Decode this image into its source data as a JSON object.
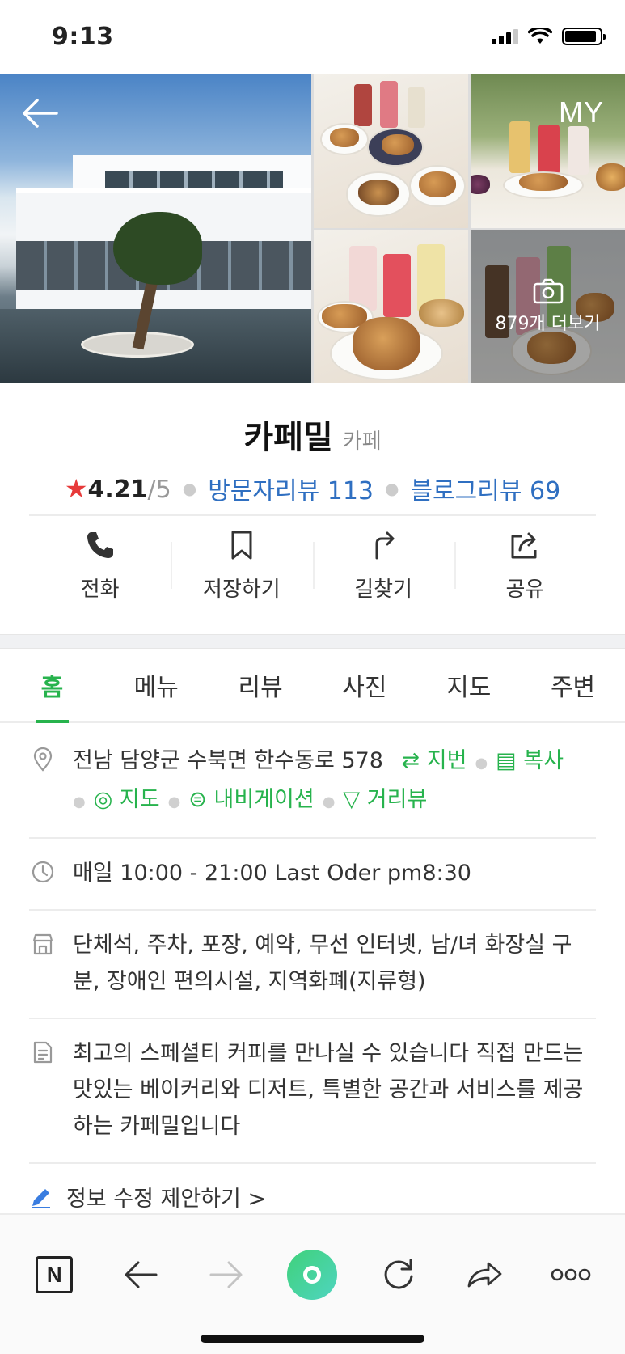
{
  "status_bar": {
    "time": "9:13",
    "signal_bars_active": 3,
    "signal_bars_total": 4,
    "battery_level_percent": 90
  },
  "header": {
    "back_icon": "arrow-left-icon",
    "my_label": "MY",
    "more_photos_label": "879개 더보기"
  },
  "place": {
    "name": "카페밀",
    "category": "카페",
    "rating": "4.21",
    "rating_max": "/5",
    "visitor_review_label": "방문자리뷰 113",
    "blog_review_label": "블로그리뷰 69"
  },
  "actions": [
    {
      "label": "전화",
      "icon": "phone-icon"
    },
    {
      "label": "저장하기",
      "icon": "bookmark-icon"
    },
    {
      "label": "길찾기",
      "icon": "directions-icon"
    },
    {
      "label": "공유",
      "icon": "share-icon"
    }
  ],
  "tabs": [
    {
      "label": "홈",
      "active": true
    },
    {
      "label": "메뉴",
      "active": false
    },
    {
      "label": "리뷰",
      "active": false
    },
    {
      "label": "사진",
      "active": false
    },
    {
      "label": "지도",
      "active": false
    },
    {
      "label": "주변",
      "active": false
    }
  ],
  "info": {
    "address": "전남 담양군 수북면 한수동로 578",
    "address_links": {
      "jibun": "지번",
      "copy": "복사",
      "map": "지도",
      "navigation": "내비게이션",
      "street_view": "거리뷰"
    },
    "hours": "매일 10:00 - 21:00 Last Oder pm8:30",
    "facilities": "단체석, 주차, 포장, 예약, 무선 인터넷, 남/녀 화장실 구분, 장애인 편의시설, 지역화폐(지류형)",
    "description": "최고의 스페셜티 커피를 만나실 수 있습니다 직접 만드는 맛있는 베이커리와 디저트, 특별한 공간과 서비스를 제공하는 카페밀입니다",
    "suggest_edit": "정보 수정 제안하기 >"
  },
  "colors": {
    "accent_green": "#27b34d",
    "link_blue": "#2f6fc1",
    "star_red": "#e73a3a"
  },
  "bottom_bar": {
    "buttons": [
      "naver-logo",
      "back-arrow-icon",
      "forward-arrow-icon",
      "home-circle",
      "reload-icon",
      "share-icon",
      "more-icon"
    ],
    "naver_label": "N"
  }
}
